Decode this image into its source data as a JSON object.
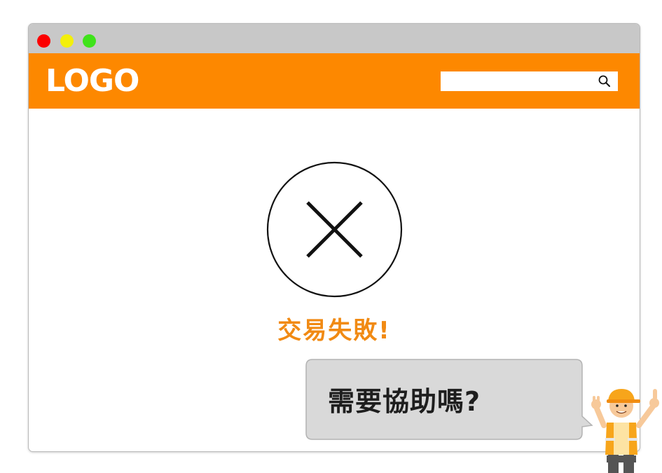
{
  "window": {
    "controls": [
      "close-dot",
      "minimize-dot",
      "maximize-dot"
    ]
  },
  "header": {
    "logo": "LOGO",
    "search": {
      "value": "",
      "placeholder": "",
      "icon": "search-icon"
    }
  },
  "main": {
    "status_icon": "x-circle-icon",
    "status_message": "交易失敗!"
  },
  "help": {
    "message": "需要協助嗎?",
    "character": "helper-mascot"
  },
  "colors": {
    "brand": "#fd8800",
    "status_text": "#f18a13",
    "titlebar": "#c8c8c8",
    "bubble": "#d9d9d9"
  }
}
